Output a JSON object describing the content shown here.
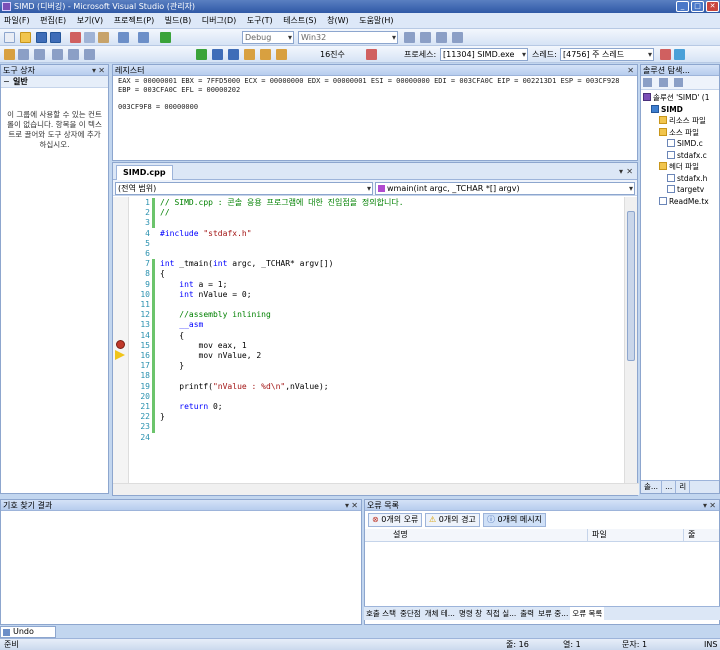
{
  "window": {
    "title": "SIMD (디버깅) - Microsoft Visual Studio (관리자)",
    "min": "_",
    "max": "□",
    "close": "✕"
  },
  "menu": [
    "파일(F)",
    "편집(E)",
    "보기(V)",
    "프로젝트(P)",
    "빌드(B)",
    "디버그(D)",
    "도구(T)",
    "테스트(S)",
    "창(W)",
    "도움말(H)"
  ],
  "toolbar1": {
    "config": "Debug",
    "platform": "Win32"
  },
  "toolbar2": {
    "hex_label": "16진수",
    "process_label": "프로세스:",
    "process_value": "[11304] SIMD.exe",
    "thread_label": "스레드:",
    "thread_value": "[4756] 주 스레드"
  },
  "toolbox": {
    "title": "도구 상자",
    "group": "일반",
    "message": "이 그룹에 사용할 수 있는 컨트롤이 없습니다. 항목을 이 텍스트로 끌어와 도구 상자에 추가하십시오."
  },
  "registers": {
    "title": "레지스터",
    "lines": [
      "EAX = 00000001 EBX = 7FFD5000 ECX = 00000000 EDX = 00000001 ESI = 00000000 EDI = 003CFA0C EIP = 002213D1 ESP = 003CF928",
      "EBP = 003CFA0C EFL = 00000202",
      "",
      "003CF9F8 = 00000000"
    ]
  },
  "editor": {
    "tab": "SIMD.cpp",
    "scope": "(전역 범위)",
    "function": "wmain(int argc, _TCHAR *[] argv)",
    "line_numbers": [
      "1",
      "2",
      "3",
      "4",
      "5",
      "6",
      "7",
      "8",
      "9",
      "10",
      "11",
      "12",
      "13",
      "14",
      "15",
      "16",
      "17",
      "18",
      "19",
      "20",
      "21",
      "22",
      "23",
      "24"
    ]
  },
  "solution": {
    "title": "솔루션 탐색...",
    "items": [
      {
        "label": "솔루션 'SIMD' (1",
        "indent": 0,
        "icon": "sol"
      },
      {
        "label": "SIMD",
        "indent": 1,
        "icon": "proj"
      },
      {
        "label": "리소스 파일",
        "indent": 2,
        "icon": "folder"
      },
      {
        "label": "소스 파일",
        "indent": 2,
        "icon": "folder"
      },
      {
        "label": "SIMD.c",
        "indent": 3,
        "icon": "file"
      },
      {
        "label": "stdafx.c",
        "indent": 3,
        "icon": "file"
      },
      {
        "label": "헤더 파일",
        "indent": 2,
        "icon": "folder"
      },
      {
        "label": "stdafx.h",
        "indent": 3,
        "icon": "file"
      },
      {
        "label": "targetv",
        "indent": 3,
        "icon": "file"
      },
      {
        "label": "ReadMe.tx",
        "indent": 2,
        "icon": "file"
      }
    ],
    "bottom_tabs": [
      "솔...",
      "...",
      "리"
    ]
  },
  "symbols": {
    "title": "기호 찾기 결과"
  },
  "errors": {
    "title": "오류 목록",
    "errors_btn": "0개의 오류",
    "warnings_btn": "0개의 경고",
    "messages_btn": "0개의 메시지",
    "col_desc": "설명",
    "col_file": "파일",
    "col_line": "줄"
  },
  "bottom_tabs": [
    "호출 스택",
    "중단점",
    "개체 테...",
    "명령 창",
    "직접 실...",
    "출력",
    "보류 중...",
    "오류 목록"
  ],
  "undo_close": "Undo Close",
  "status": {
    "ready": "준비",
    "line": "줄: 16",
    "col": "열: 1",
    "char": "문자: 1",
    "ins": "INS"
  }
}
